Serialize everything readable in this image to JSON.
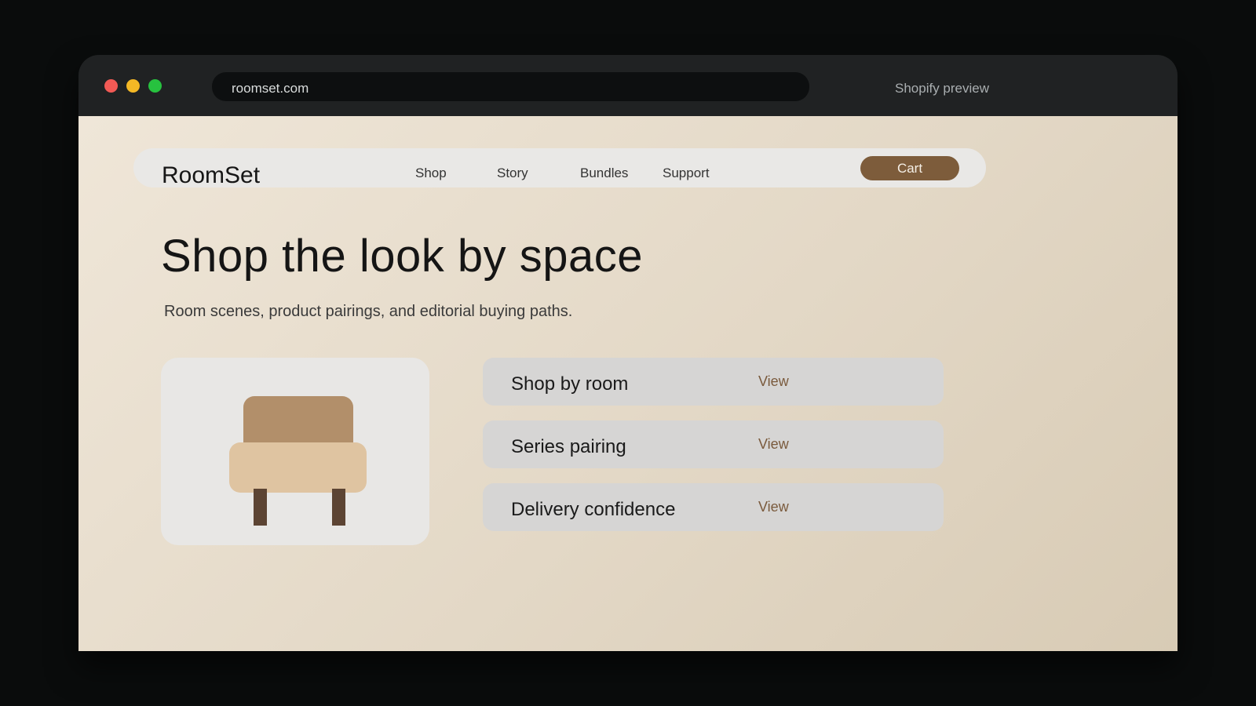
{
  "browser": {
    "url": "roomset.com",
    "preview_label": "Shopify preview"
  },
  "nav": {
    "brand": "RoomSet",
    "links": [
      "Shop",
      "Story",
      "Bundles",
      "Support"
    ],
    "cart_label": "Cart"
  },
  "hero": {
    "title": "Shop the look by space",
    "subtitle": "Room scenes, product pairings, and editorial buying paths."
  },
  "product_card": {
    "icon": "armchair-icon"
  },
  "paths": [
    {
      "label": "Shop by room",
      "link": "View"
    },
    {
      "label": "Series pairing",
      "link": "View"
    },
    {
      "label": "Delivery confidence",
      "link": "View"
    }
  ],
  "colors": {
    "accent": "#7d5c3b",
    "chair_back": "#b28f6a",
    "chair_seat": "#dfc4a1",
    "chair_legs": "#5c4433"
  }
}
